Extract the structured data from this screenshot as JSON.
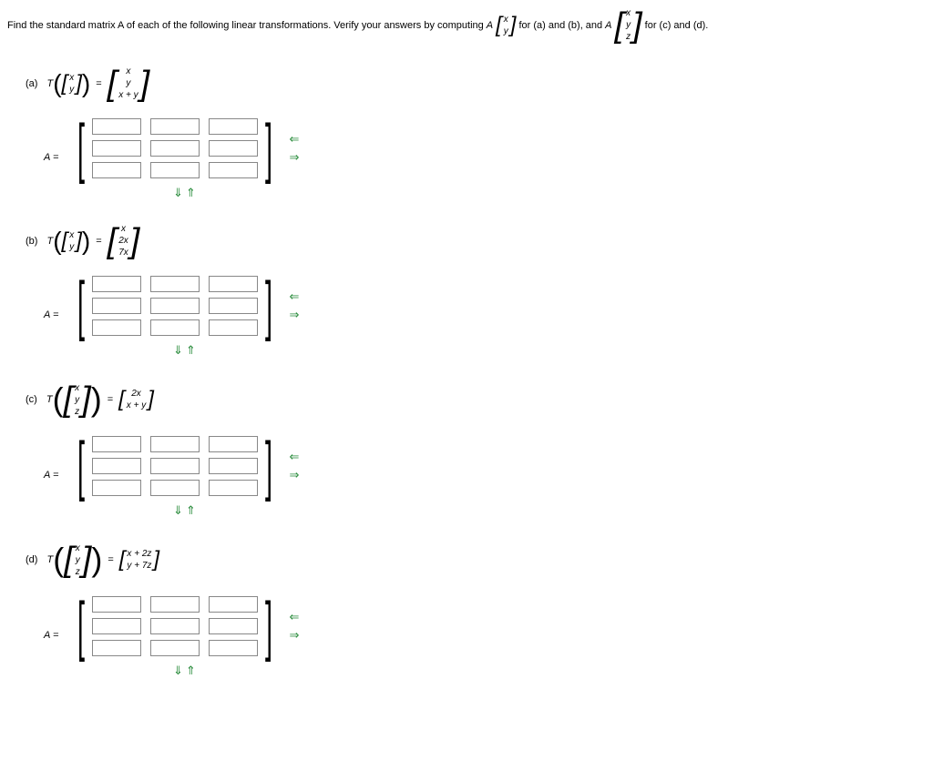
{
  "problem": {
    "intro": "Find the standard matrix A of each of the following linear transformations. Verify your answers by computing ",
    "vec2_x": "x",
    "vec2_y": "y",
    "mid1": " for (a) and (b), and ",
    "vec3_x": "x",
    "vec3_y": "y",
    "vec3_z": "z",
    "mid2": " for (c) and (d).",
    "A_label": "A"
  },
  "parts": {
    "a": {
      "label": "(a)",
      "T": "T",
      "in1": "x",
      "in2": "y",
      "out1": "x",
      "out2": "y",
      "out3": "x + y",
      "eq": "=",
      "A_equals": "A ="
    },
    "b": {
      "label": "(b)",
      "T": "T",
      "in1": "x",
      "in2": "y",
      "out1": "x",
      "out2": "2x",
      "out3": "7x",
      "eq": "=",
      "A_equals": "A ="
    },
    "c": {
      "label": "(c)",
      "T": "T",
      "in1": "x",
      "in2": "y",
      "in3": "z",
      "out1": "2x",
      "out2": "x + y",
      "eq": "=",
      "A_equals": "A ="
    },
    "d": {
      "label": "(d)",
      "T": "T",
      "in1": "x",
      "in2": "y",
      "in3": "z",
      "out1": "x + 2z",
      "out2": "y + 7z",
      "eq": "=",
      "A_equals": "A ="
    }
  },
  "arrows": {
    "left": "⇐",
    "right": "⇒",
    "down": "⇓",
    "up": "⇑"
  }
}
